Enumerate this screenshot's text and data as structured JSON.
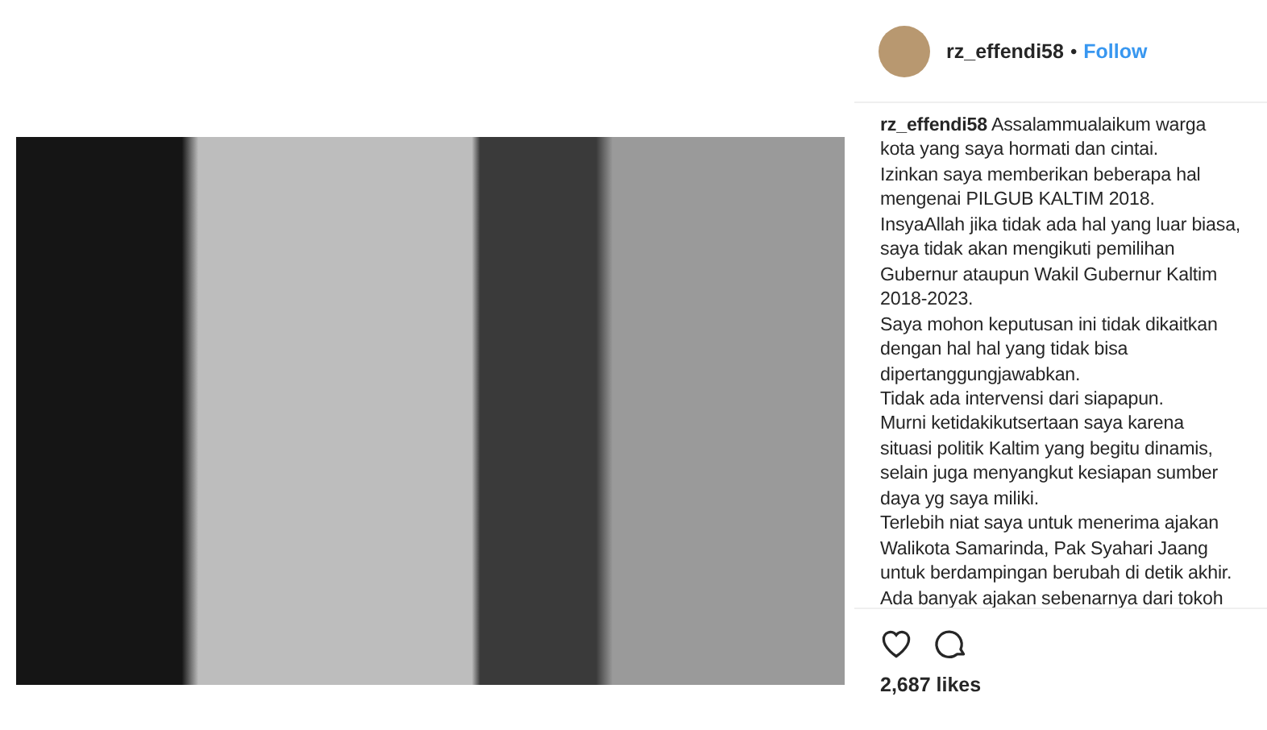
{
  "header": {
    "username": "rz_effendi58",
    "separator": "•",
    "follow": "Follow"
  },
  "caption": {
    "lines": [
      "**rz_effendi58** Assalammualaikum warga",
      "kota yang saya hormati dan cintai.",
      "Izinkan saya memberikan beberapa hal",
      "mengenai PILGUB KALTIM 2018.",
      "InsyaAllah jika tidak ada hal yang luar biasa,",
      "saya tidak akan mengikuti pemilihan",
      "Gubernur ataupun Wakil Gubernur Kaltim",
      "2018-2023.",
      "Saya mohon keputusan ini tidak dikaitkan",
      "dengan hal hal yang tidak bisa",
      "dipertanggungjawabkan.",
      "Tidak ada intervensi dari siapapun.",
      "Murni ketidakikutsertaan saya karena",
      "situasi politik Kaltim yang begitu dinamis,",
      "selain juga menyangkut kesiapan sumber",
      "daya yg saya miliki.",
      "Terlebih niat saya untuk menerima ajakan",
      "Walikota Samarinda, Pak Syahari Jaang",
      "untuk berdampingan berubah di detik akhir.",
      "Ada banyak ajakan sebenarnya dari tokoh"
    ]
  },
  "actions": {
    "liked": false
  },
  "likes": "2,687 likes"
}
